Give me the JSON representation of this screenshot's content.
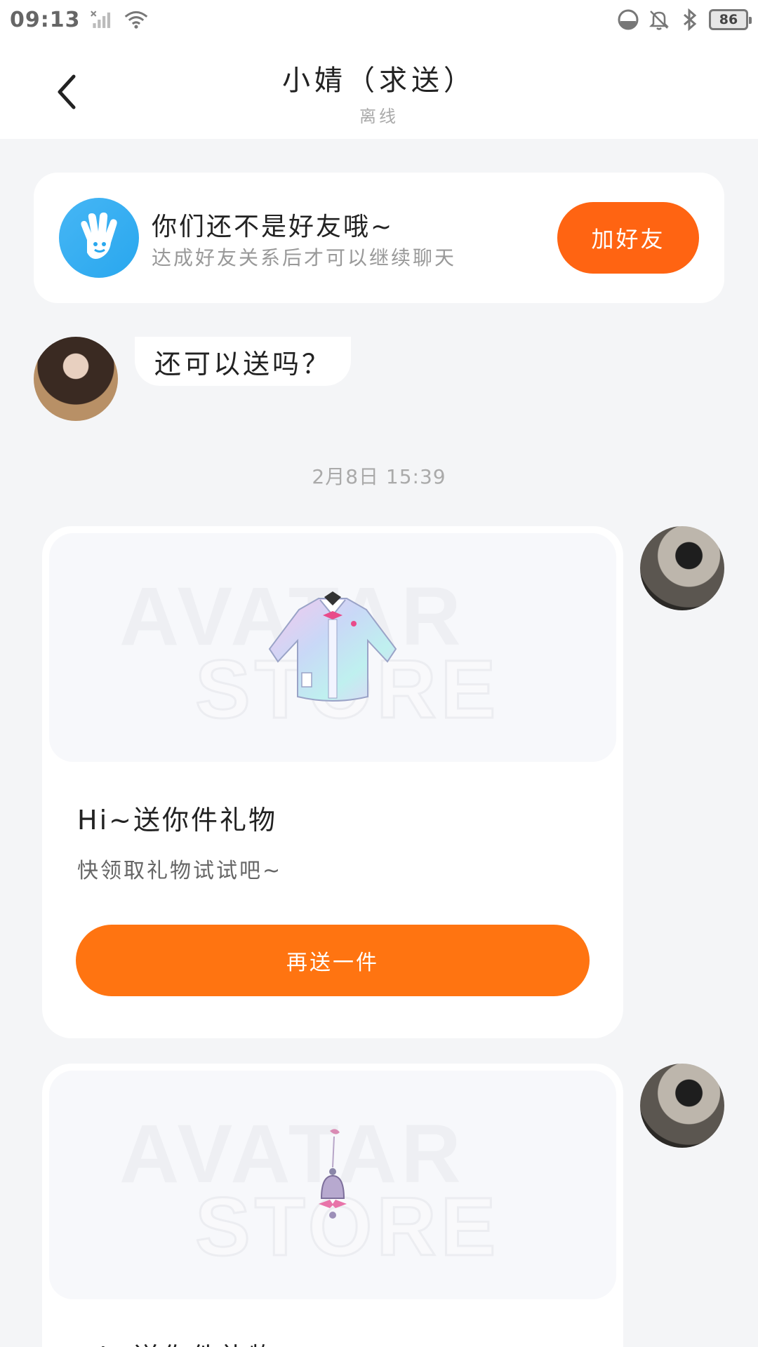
{
  "status_bar": {
    "time": "09:13",
    "battery": "86",
    "icons": [
      "no-signal-icon",
      "wifi-icon",
      "data-saver-icon",
      "mute-bell-icon",
      "bluetooth-icon",
      "battery-icon"
    ]
  },
  "header": {
    "title": "小婧（求送）",
    "subtitle": "离线",
    "back_icon": "chevron-left-icon"
  },
  "friend_banner": {
    "icon": "waving-hand-icon",
    "title": "你们还不是好友哦~",
    "subtitle": "达成好友关系后才可以继续聊天",
    "button_label": "加好友",
    "accent": "#ff6412"
  },
  "messages": {
    "incoming_text": "还可以送吗？",
    "timestamp": "2月8日 15:39"
  },
  "gift_cards": [
    {
      "watermark_line1": "AVATAR",
      "watermark_line2": "STORE",
      "title": "Hi~送你件礼物",
      "description": "快领取礼物试试吧~",
      "button_label": "再送一件",
      "item_icon": "jacket-icon"
    },
    {
      "watermark_line1": "AVATAR",
      "watermark_line2": "STORE",
      "title": "Hi~送你件礼物",
      "item_icon": "bell-ornament-icon"
    }
  ],
  "colors": {
    "orange": "#ff7411",
    "blue": "#29a7ee",
    "background": "#f4f5f7"
  }
}
